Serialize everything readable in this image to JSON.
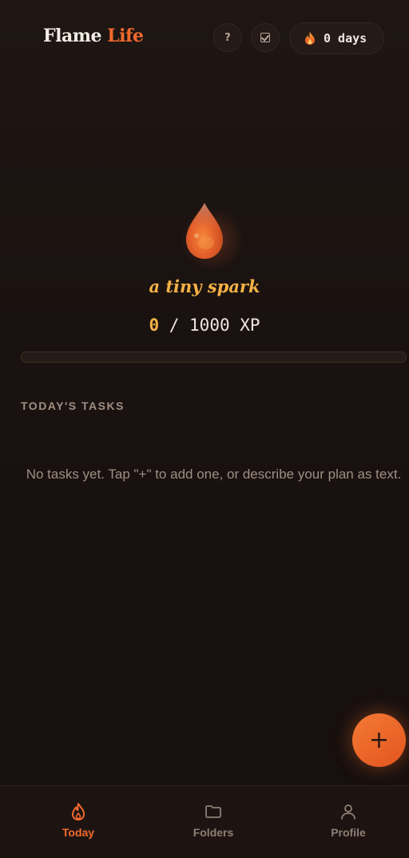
{
  "app": {
    "brand_part1": "Flame",
    "brand_part2": "Life"
  },
  "header": {
    "help_label": "?",
    "streak_text": "0 days",
    "icons": [
      "help-icon",
      "checkbox-icon",
      "flame-icon"
    ]
  },
  "hero": {
    "level_name": "a tiny spark",
    "xp_current": "0",
    "xp_rest": " / 1000 XP",
    "progress_fraction": 0
  },
  "tasks": {
    "section_title": "TODAY'S TASKS",
    "empty_message": "No tasks yet. Tap \"+\" to add one, or describe your plan as text."
  },
  "fab": {
    "label": "+"
  },
  "nav": {
    "items": [
      {
        "label": "Today",
        "icon": "flame-icon",
        "active": true
      },
      {
        "label": "Folders",
        "icon": "folder-icon",
        "active": false
      },
      {
        "label": "Profile",
        "icon": "user-icon",
        "active": false
      }
    ]
  },
  "colors": {
    "accent": "#f26a2e",
    "gold": "#f5b246",
    "background": "#1a1210"
  }
}
